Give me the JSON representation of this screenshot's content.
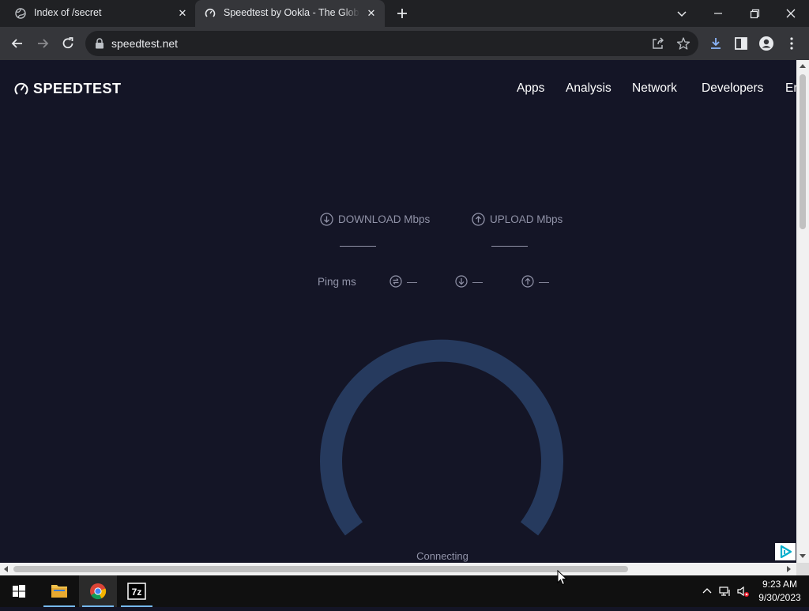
{
  "browser": {
    "tabs": [
      {
        "title": "Index of /secret"
      },
      {
        "title": "Speedtest by Ookla - The Global Broadband Speed Test"
      }
    ],
    "url": "speedtest.net"
  },
  "site": {
    "logo": "SPEEDTEST",
    "nav": [
      {
        "label": "Apps"
      },
      {
        "label": "Analysis"
      },
      {
        "label": "Network"
      },
      {
        "label": "Developers"
      },
      {
        "label": "Enterprise"
      }
    ],
    "download_label": "DOWNLOAD Mbps",
    "upload_label": "UPLOAD Mbps",
    "ping_label": "Ping ms",
    "ping_values": [
      {
        "icon": "jitter-icon",
        "value": "—"
      },
      {
        "icon": "download-icon",
        "value": "—"
      },
      {
        "icon": "upload-icon",
        "value": "—"
      }
    ],
    "status": "Connecting"
  },
  "taskbar": {
    "apps": [
      "windows-start",
      "file-explorer",
      "chrome",
      "7-zip"
    ],
    "time": "9:23 AM",
    "date": "9/30/2023"
  },
  "colors": {
    "page_bg": "#141526",
    "gauge": "#263a5e",
    "muted_text": "#9193a8"
  }
}
